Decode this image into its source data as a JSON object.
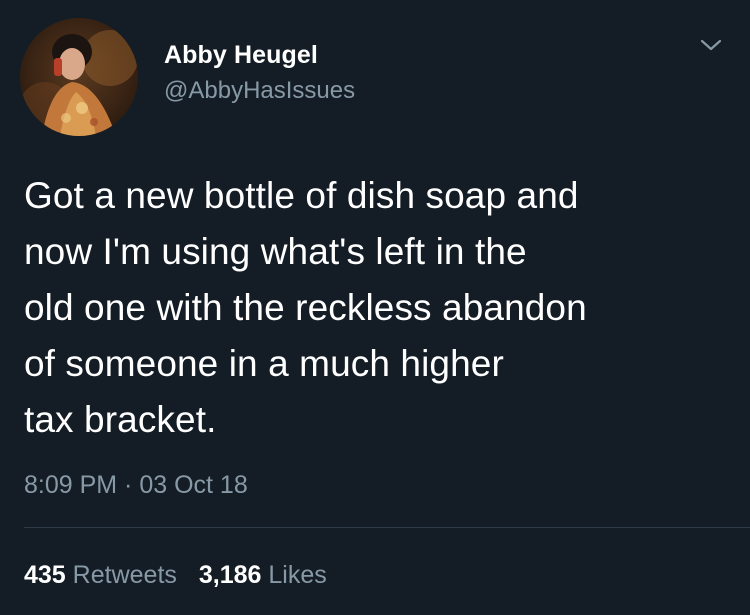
{
  "user": {
    "display_name": "Abby Heugel",
    "handle": "@AbbyHasIssues"
  },
  "tweet": {
    "text": "Got a new bottle of dish soap and\nnow I'm using what's left in the\nold one with the reckless abandon\nof someone in a much higher\ntax bracket.",
    "timestamp": "8:09 PM · 03 Oct 18"
  },
  "stats": {
    "retweets_count": "435",
    "retweets_label": "Retweets",
    "likes_count": "3,186",
    "likes_label": "Likes"
  },
  "icons": {
    "menu": "chevron-down-icon"
  },
  "colors": {
    "background": "#141d26",
    "primary_text": "#ffffff",
    "secondary_text": "#8899a6",
    "divider": "#2c3a47"
  }
}
